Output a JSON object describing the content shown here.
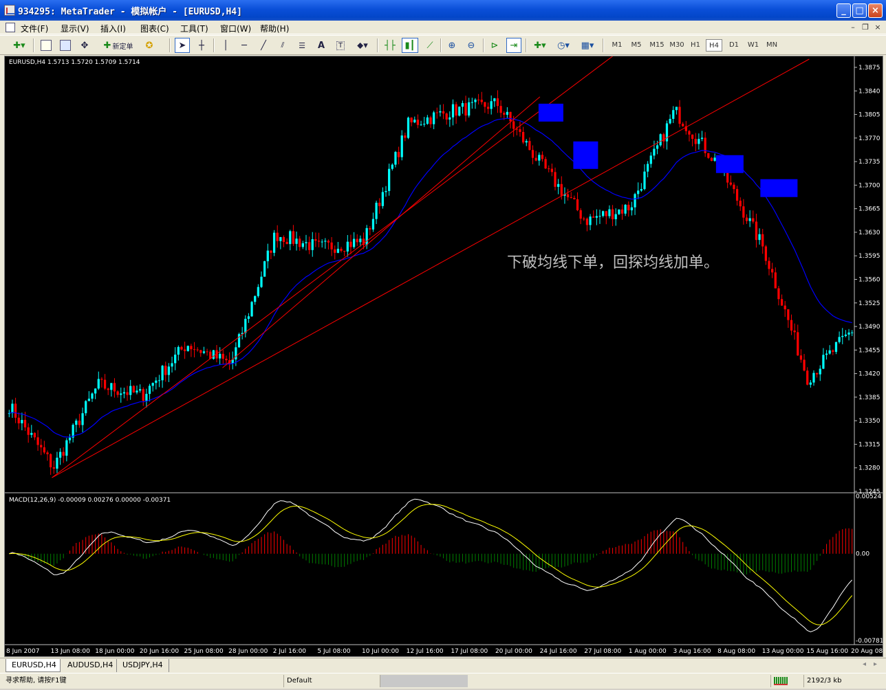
{
  "window": {
    "title": "934295: MetaTrader - 模拟帐户 - [EURUSD,H4]",
    "btn_min": "_",
    "btn_max": "□",
    "btn_close": "×"
  },
  "menu": {
    "items": [
      "文件(F)",
      "显示(V)",
      "插入(I)",
      "图表(C)",
      "工具(T)",
      "窗口(W)",
      "帮助(H)"
    ],
    "mdi_min": "–",
    "mdi_restore": "❐",
    "mdi_close": "×"
  },
  "toolbar": {
    "new_order_label": "新定单",
    "timeframes": [
      "M1",
      "M5",
      "M15",
      "M30",
      "H1",
      "H4",
      "D1",
      "W1",
      "MN"
    ],
    "active_timeframe": "H4",
    "icons": [
      "new-chart-icon",
      "market-watch-icon",
      "data-window-icon",
      "navigator-icon",
      "new-order-icon",
      "expert-advisors-icon",
      "cursor-icon",
      "crosshair-icon",
      "vertical-line-icon",
      "horizontal-line-icon",
      "trendline-icon",
      "fibonacci-icon",
      "channel-icon",
      "text-icon",
      "text-label-icon",
      "arrows-icon",
      "bar-chart-icon",
      "candlestick-icon",
      "line-chart-icon",
      "zoom-in-icon",
      "zoom-out-icon",
      "auto-scroll-icon",
      "chart-shift-icon",
      "indicators-icon",
      "periods-icon",
      "templates-icon"
    ]
  },
  "chart": {
    "info": "EURUSD,H4  1.5713 1.5720 1.5709 1.5714",
    "annotation": "下破均线下单，回探均线加单。",
    "macd_label": "MACD(12,26,9) -0.00009 0.00276 0.00000 -0.00371",
    "price_axis": [
      "1.3875",
      "1.3840",
      "1.3805",
      "1.3770",
      "1.3735",
      "1.3700",
      "1.3665",
      "1.3630",
      "1.3595",
      "1.3560",
      "1.3525",
      "1.3490",
      "1.3455",
      "1.3420",
      "1.3385",
      "1.3350",
      "1.3315",
      "1.3280",
      "1.3245"
    ],
    "macd_axis": [
      "0.00524",
      "0.00",
      "-0.00781"
    ],
    "time_axis": [
      "8 Jun 2007",
      "13 Jun 08:00",
      "18 Jun 00:00",
      "20 Jun 16:00",
      "25 Jun 08:00",
      "28 Jun 00:00",
      "2 Jul 16:00",
      "5 Jul 08:00",
      "10 Jul 00:00",
      "12 Jul 16:00",
      "17 Jul 08:00",
      "20 Jul 00:00",
      "24 Jul 16:00",
      "27 Jul 08:00",
      "1 Aug 00:00",
      "3 Aug 16:00",
      "8 Aug 08:00",
      "13 Aug 00:00",
      "15 Aug 16:00",
      "20 Aug 08:00"
    ],
    "colors": {
      "background": "#000000",
      "bull": "#00ffff",
      "bear": "#ff0000",
      "ma": "#0000ff",
      "trendline": "#ff0000",
      "marker": "#0000ff",
      "macd_pos": "#ff0000",
      "macd_neg": "#008000",
      "signal_white": "#ffffff",
      "signal_yellow": "#ffff00",
      "annotation": "#c0c0c0"
    }
  },
  "chart_data": {
    "type": "candlestick",
    "symbol": "EURUSD",
    "timeframe": "H4",
    "close_path": [
      {
        "x": "8 Jun 2007",
        "y": 1.337
      },
      {
        "x": "13 Jun 08:00",
        "y": 1.328
      },
      {
        "x": "18 Jun 00:00",
        "y": 1.34
      },
      {
        "x": "20 Jun 16:00",
        "y": 1.3385
      },
      {
        "x": "25 Jun 08:00",
        "y": 1.346
      },
      {
        "x": "28 Jun 00:00",
        "y": 1.343
      },
      {
        "x": "2 Jul 16:00",
        "y": 1.362
      },
      {
        "x": "5 Jul 08:00",
        "y": 1.36
      },
      {
        "x": "10 Jul 00:00",
        "y": 1.361
      },
      {
        "x": "12 Jul 16:00",
        "y": 1.378
      },
      {
        "x": "17 Jul 08:00",
        "y": 1.38
      },
      {
        "x": "20 Jul 00:00",
        "y": 1.381
      },
      {
        "x": "24 Jul 16:00",
        "y": 1.372
      },
      {
        "x": "27 Jul 08:00",
        "y": 1.364
      },
      {
        "x": "1 Aug 00:00",
        "y": 1.366
      },
      {
        "x": "3 Aug 16:00",
        "y": 1.38
      },
      {
        "x": "8 Aug 08:00",
        "y": 1.372
      },
      {
        "x": "13 Aug 00:00",
        "y": 1.36
      },
      {
        "x": "15 Aug 16:00",
        "y": 1.341
      },
      {
        "x": "20 Aug 08:00",
        "y": 1.348
      }
    ],
    "ylim": [
      1.3245,
      1.3875
    ],
    "macd_ylim": [
      -0.00781,
      0.00524
    ]
  },
  "tabs": [
    "EURUSD,H4",
    "AUDUSD,H4",
    "USDJPY,H4"
  ],
  "status": {
    "help": "寻求帮助, 请按F1键",
    "profile": "Default",
    "traffic": "2192/3 kb"
  }
}
